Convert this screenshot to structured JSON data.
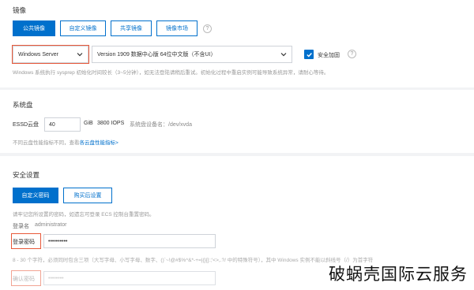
{
  "image_section": {
    "title": "镜像",
    "tabs": [
      {
        "label": "公共镜像",
        "active": true
      },
      {
        "label": "自定义镜像",
        "active": false
      },
      {
        "label": "共享镜像",
        "active": false
      },
      {
        "label": "镜像市场",
        "active": false
      }
    ],
    "os_select": "Windows Server",
    "version_select": "Version 1909 数据中心版 64位中文版（不含UI）",
    "security_hardening_label": "安全加固",
    "security_hardening_checked": true,
    "hint": "Windows 系统执行 sysprep 初始化时间较长（3~5分钟），如无法登陆请稍后重试。初始化过程中重启实例可能导致系统异常，请耐心等待。"
  },
  "disk_section": {
    "title": "系统盘",
    "disk_type": "ESSD云盘",
    "size_value": "40",
    "size_unit": "GiB",
    "iops": "3800 IOPS",
    "device_label": "系统盘设备名：/dev/xvda",
    "hint_prefix": "不同云盘性能指标不同，查看",
    "hint_link": "各云盘性能指标>"
  },
  "security_section": {
    "title": "安全设置",
    "tabs": [
      {
        "label": "自定义密码",
        "active": true
      },
      {
        "label": "购买后设置",
        "active": false
      }
    ],
    "hint": "请牢记您所设置的密码，如遗忘可登录 ECS 控制台重置密码。",
    "login_name_label": "登录名",
    "login_name_value": "administrator",
    "password_label": "登录密码",
    "password_value": "••••••••••",
    "password_rule": "8 - 30 个字符，必须同时包含三项（大写字母、小写字母、数字、()`~!@#$%^&*-+=|{}[]:;'<>,.?/ 中的特殊符号），其中 Windows 实例不能以斜线号（/）为首字符",
    "confirm_label": "确认密码",
    "confirm_value": "••••••••"
  },
  "watermark": "破蜗壳国际云服务",
  "colors": {
    "accent": "#0070cc",
    "highlight": "#e8593a"
  }
}
